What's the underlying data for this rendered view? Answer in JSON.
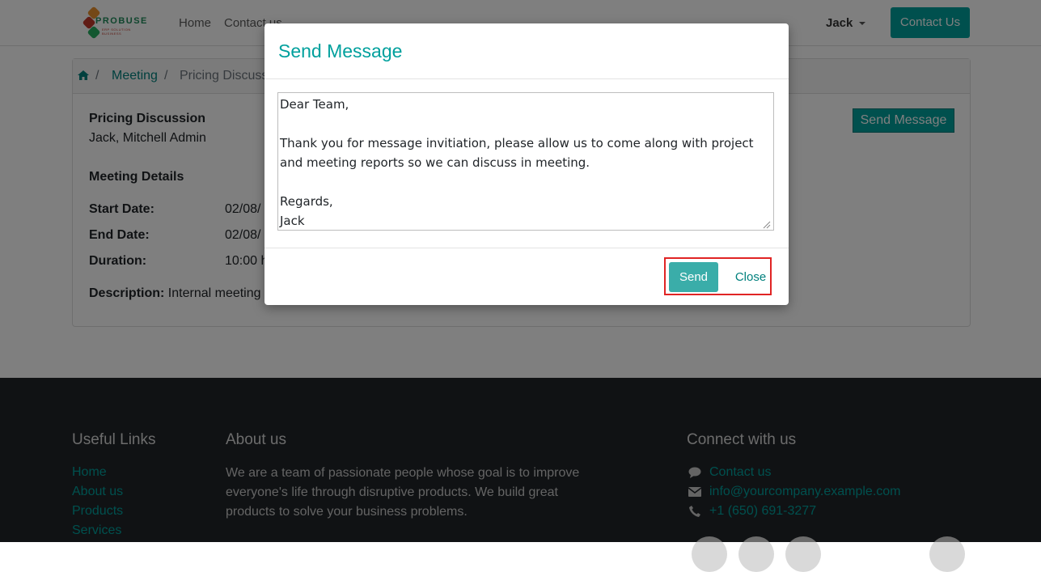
{
  "header": {
    "logo_text": "PROBUSE",
    "logo_tagline": "ERP SOLUTION BUSINESS",
    "nav": [
      "Home",
      "Contact us"
    ],
    "user": "Jack",
    "contact_button": "Contact Us"
  },
  "breadcrumb": {
    "sep": "/",
    "meeting": "Meeting",
    "current": "Pricing Discussion"
  },
  "meeting": {
    "title": "Pricing Discussion",
    "attendees": "Jack, Mitchell Admin",
    "details_heading": "Meeting Details",
    "start_label": "Start Date:",
    "start_value": "02/08/",
    "end_label": "End Date:",
    "end_value": "02/08/",
    "duration_label": "Duration:",
    "duration_value": "10:00 h",
    "description_label": "Description:",
    "description_value": "Internal meeting fo",
    "send_message_button": "Send Message"
  },
  "modal": {
    "title": "Send Message",
    "message": "Dear Team,\n\nThank you for message invitiation, please allow us to come along with project and meeting reports so we can discuss in meeting.\n\nRegards,\nJack",
    "send_button": "Send",
    "close_button": "Close"
  },
  "footer": {
    "useful_links_heading": "Useful Links",
    "useful_links": [
      "Home",
      "About us",
      "Products",
      "Services"
    ],
    "about_heading": "About us",
    "about_text": "We are a team of passionate people whose goal is to improve everyone's life through disruptive products. We build great products to solve your business problems.",
    "connect_heading": "Connect with us",
    "contact_link": "Contact us",
    "email": "info@yourcompany.example.com",
    "phone": "+1 (650) 691-3277"
  },
  "colors": {
    "accent": "#00a09d",
    "footer_bg": "#212529",
    "highlight": "#e02424"
  }
}
